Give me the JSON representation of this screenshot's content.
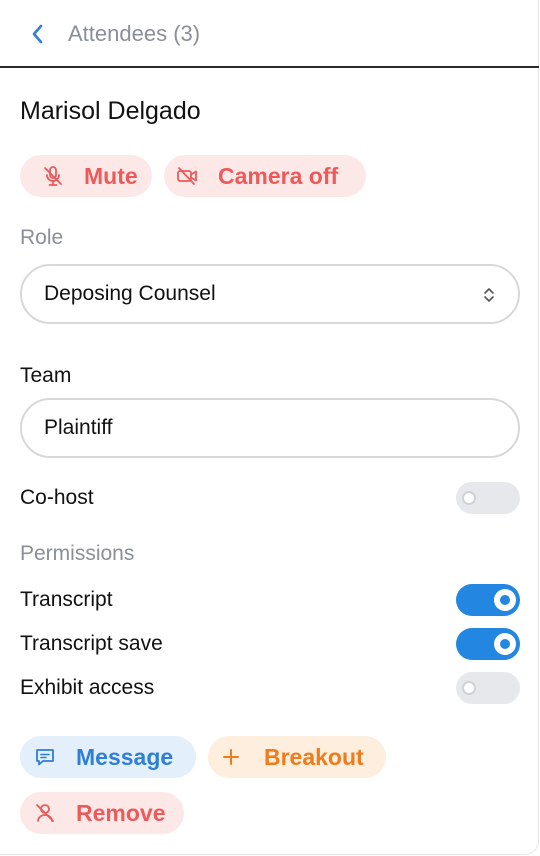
{
  "header": {
    "title": "Attendees (3)"
  },
  "attendee": {
    "name": "Marisol Delgado"
  },
  "actions": {
    "mute": "Mute",
    "camera_off": "Camera off",
    "message": "Message",
    "breakout": "Breakout",
    "remove": "Remove"
  },
  "role": {
    "label": "Role",
    "value": "Deposing Counsel"
  },
  "team": {
    "label": "Team",
    "value": "Plaintiff"
  },
  "cohost": {
    "label": "Co-host",
    "enabled": false
  },
  "permissions": {
    "label": "Permissions",
    "items": [
      {
        "label": "Transcript",
        "enabled": true
      },
      {
        "label": "Transcript save",
        "enabled": true
      },
      {
        "label": "Exhibit access",
        "enabled": false
      }
    ]
  },
  "colors": {
    "accent_blue": "#2386e0",
    "danger_red": "#ec5a5a",
    "warning_orange": "#ef7c1c"
  }
}
